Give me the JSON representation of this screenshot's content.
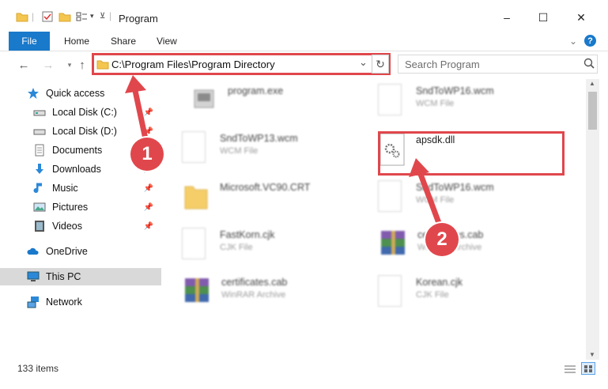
{
  "window": {
    "title": "Program",
    "minimize": "–",
    "maximize": "☐",
    "close": "✕"
  },
  "ribbon": {
    "tabs": [
      "File",
      "Home",
      "Share",
      "View"
    ],
    "collapse": "⌄",
    "help": "?"
  },
  "address": {
    "path": "C:\\Program Files\\Program Directory",
    "refresh": "↻",
    "dropdown": "⌄"
  },
  "search": {
    "placeholder": "Search Program",
    "icon": "search-icon"
  },
  "sidebar": {
    "items": [
      {
        "label": "Quick access",
        "icon": "star-icon",
        "pinned": false
      },
      {
        "label": "Local Disk (C:)",
        "icon": "drive-icon",
        "pinned": true
      },
      {
        "label": "Local Disk (D:)",
        "icon": "drive-icon",
        "pinned": true
      },
      {
        "label": "Documents",
        "icon": "documents-icon",
        "pinned": true
      },
      {
        "label": "Downloads",
        "icon": "downloads-icon",
        "pinned": true
      },
      {
        "label": "Music",
        "icon": "music-icon",
        "pinned": true
      },
      {
        "label": "Pictures",
        "icon": "pictures-icon",
        "pinned": true
      },
      {
        "label": "Videos",
        "icon": "videos-icon",
        "pinned": true
      },
      {
        "label": "OneDrive",
        "icon": "cloud-icon",
        "pinned": false
      },
      {
        "label": "This PC",
        "icon": "pc-icon",
        "pinned": false
      },
      {
        "label": "Network",
        "icon": "network-icon",
        "pinned": false
      }
    ]
  },
  "files": [
    {
      "name": "program.exe",
      "type": ""
    },
    {
      "name": "SndToWP16.wcm",
      "type": "WCM File"
    },
    {
      "name": "SndToWP13.wcm",
      "type": "WCM File"
    },
    {
      "name": "apsdk.dll",
      "type": ""
    },
    {
      "name": "Microsoft.VC90.CRT",
      "type": ""
    },
    {
      "name": "SndToWP16.wcm",
      "type": "WCM File"
    },
    {
      "name": "FastKorn.cjk",
      "type": "CJK File"
    },
    {
      "name": "certificates.cab",
      "type": "WinRAR Archive"
    },
    {
      "name": "certificates.cab",
      "type": "WinRAR Archive"
    },
    {
      "name": "Korean.cjk",
      "type": "CJK File"
    }
  ],
  "status": {
    "count": "133 items"
  },
  "annotations": {
    "step1": "1",
    "step2": "2"
  }
}
